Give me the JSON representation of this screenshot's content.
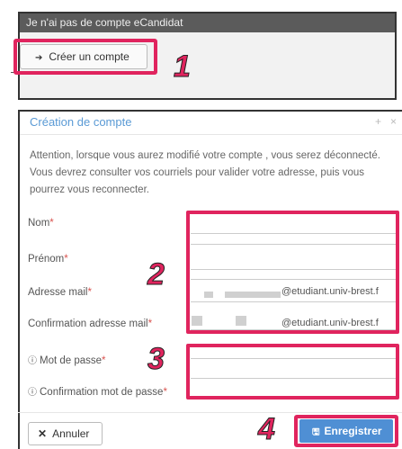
{
  "top_panel": {
    "header": "Je n'ai pas de compte eCandidat",
    "create_button": "Créer un compte",
    "create_icon": "sign-in-icon"
  },
  "modal": {
    "title": "Création de compte",
    "controls": [
      "+",
      "×"
    ],
    "notice": "Attention, lorsque vous aurez modifié votre compte , vous serez déconnecté. Vous devrez consulter vos courriels pour valider votre adresse, puis vous pourrez vous reconnecter.",
    "fields": {
      "nom": {
        "label": "Nom",
        "required": "*"
      },
      "prenom": {
        "label": "Prénom",
        "required": "*"
      },
      "email": {
        "label": "Adresse mail",
        "required": "*",
        "value_suffix": "@etudiant.univ-brest.f"
      },
      "email_confirm": {
        "label": "Confirmation adresse mail",
        "required": "*",
        "value_suffix": "@etudiant.univ-brest.f"
      },
      "password": {
        "label": "Mot de passe",
        "required": "*",
        "icon": "info-icon"
      },
      "password_confirm": {
        "label": "Confirmation mot de passe",
        "required": "*",
        "icon": "info-icon"
      }
    },
    "buttons": {
      "cancel": "Annuler",
      "save": "Enregistrer"
    }
  },
  "annotations": [
    "1",
    "2",
    "3",
    "4"
  ],
  "colors": {
    "highlight": "#e0245e",
    "primary": "#4f8fd4",
    "title": "#5a9ad5",
    "panel_header": "#5b5b5b"
  }
}
